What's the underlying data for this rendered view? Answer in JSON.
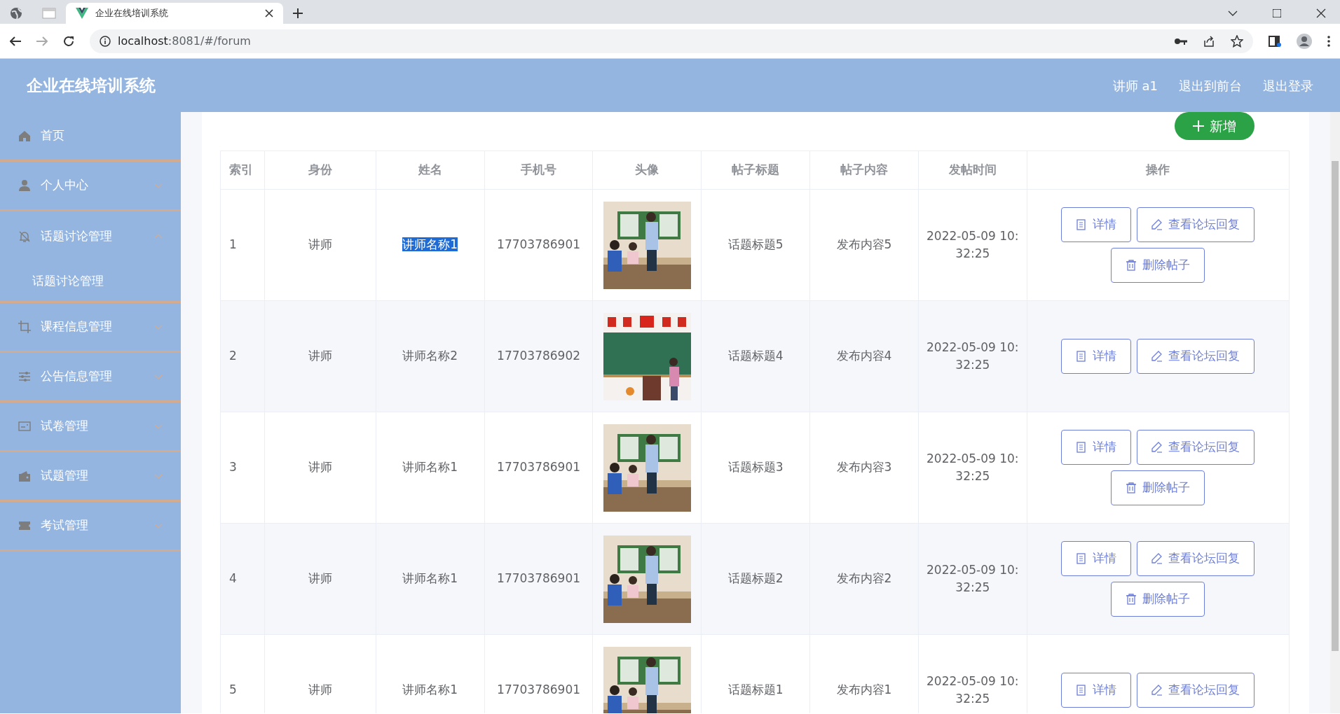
{
  "browser": {
    "tabs": [
      {
        "kind": "globe",
        "selected": false
      },
      {
        "kind": "blank",
        "selected": false
      },
      {
        "kind": "page",
        "title": "企业在线培训系统",
        "selected": true
      }
    ],
    "url_host": "localhost",
    "url_rest": ":8081/#/forum"
  },
  "header": {
    "title": "企业在线培训系统",
    "links": [
      "讲师 a1",
      "退出到前台",
      "退出登录"
    ]
  },
  "sidebar": {
    "items": [
      {
        "label": "首页"
      },
      {
        "label": "个人中心",
        "expanded": false
      },
      {
        "label": "话题讨论管理",
        "expanded": true,
        "children": [
          {
            "label": "话题讨论管理"
          }
        ]
      },
      {
        "label": "课程信息管理",
        "expanded": false
      },
      {
        "label": "公告信息管理",
        "expanded": false
      },
      {
        "label": "试卷管理",
        "expanded": false
      },
      {
        "label": "试题管理",
        "expanded": false
      },
      {
        "label": "考试管理",
        "expanded": false
      }
    ]
  },
  "add_button": {
    "label": "新增"
  },
  "table": {
    "columns": [
      "索引",
      "身份",
      "姓名",
      "手机号",
      "头像",
      "帖子标题",
      "帖子内容",
      "发帖时间",
      "操作"
    ],
    "rows": [
      {
        "index": "1",
        "role": "讲师",
        "name": "讲师名称1",
        "name_highlighted": true,
        "phone": "17703786901",
        "avatar": {
          "kind": "picture"
        },
        "title": "话题标题5",
        "content": "发布内容5",
        "time": "2022-05-09 10:32:25",
        "actions": [
          {
            "kind": "detail",
            "label": "详情"
          },
          {
            "kind": "reply",
            "label": "查看论坛回复"
          },
          {
            "kind": "delete",
            "label": "删除帖子"
          }
        ]
      },
      {
        "index": "2",
        "role": "讲师",
        "name": "讲师名称2",
        "name_highlighted": false,
        "phone": "17703786902",
        "avatar": {
          "kind": "picture"
        },
        "title": "话题标题4",
        "content": "发布内容4",
        "time": "2022-05-09 10:32:25",
        "actions": [
          {
            "kind": "detail",
            "label": "详情"
          },
          {
            "kind": "reply",
            "label": "查看论坛回复"
          }
        ]
      },
      {
        "index": "3",
        "role": "讲师",
        "name": "讲师名称1",
        "name_highlighted": false,
        "phone": "17703786901",
        "avatar": {
          "kind": "picture"
        },
        "title": "话题标题3",
        "content": "发布内容3",
        "time": "2022-05-09 10:32:25",
        "actions": [
          {
            "kind": "detail",
            "label": "详情"
          },
          {
            "kind": "reply",
            "label": "查看论坛回复"
          },
          {
            "kind": "delete",
            "label": "删除帖子"
          }
        ]
      },
      {
        "index": "4",
        "role": "讲师",
        "name": "讲师名称1",
        "name_highlighted": false,
        "phone": "17703786901",
        "avatar": {
          "kind": "picture"
        },
        "title": "话题标题2",
        "content": "发布内容2",
        "time": "2022-05-09 10:32:25",
        "actions": [
          {
            "kind": "detail",
            "label": "详情"
          },
          {
            "kind": "reply",
            "label": "查看论坛回复"
          },
          {
            "kind": "delete",
            "label": "删除帖子"
          }
        ]
      },
      {
        "index": "5",
        "role": "讲师",
        "name": "讲师名称1",
        "name_highlighted": false,
        "phone": "17703786901",
        "avatar": {
          "kind": "picture"
        },
        "title": "话题标题1",
        "content": "发布内容1",
        "time": "2022-05-09 10:32:25",
        "actions": [
          {
            "kind": "detail",
            "label": "详情"
          },
          {
            "kind": "reply",
            "label": "查看论坛回复"
          }
        ]
      }
    ]
  }
}
